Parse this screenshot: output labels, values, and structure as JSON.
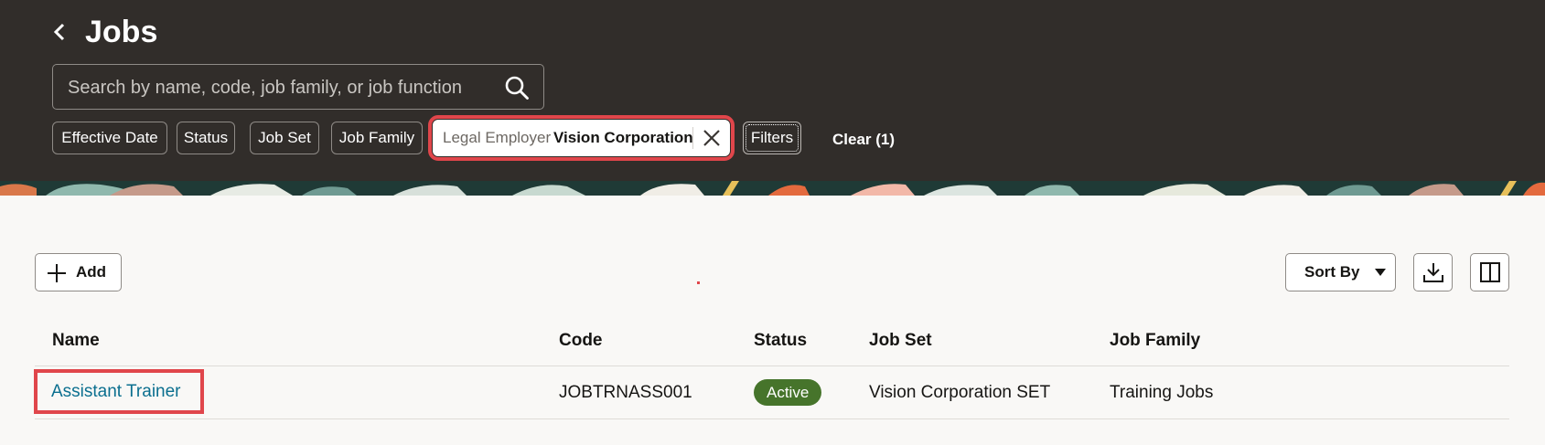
{
  "header": {
    "title": "Jobs",
    "back_icon": "chevron-left-icon"
  },
  "search": {
    "placeholder": "Search by name, code, job family, or job function",
    "value": ""
  },
  "filter_chips": [
    {
      "label": "Effective Date"
    },
    {
      "label": "Status"
    },
    {
      "label": "Job Set"
    },
    {
      "label": "Job Family"
    }
  ],
  "applied_filter": {
    "label": "Legal Employer",
    "value": "Vision Corporation"
  },
  "filters_button": "Filters",
  "clear_link": "Clear (1)",
  "toolbar": {
    "add_label": "Add",
    "sort_label": "Sort By"
  },
  "table": {
    "columns": [
      "Name",
      "Code",
      "Status",
      "Job Set",
      "Job Family"
    ],
    "rows": [
      {
        "name": "Assistant Trainer",
        "code": "JOBTRNASS001",
        "status": "Active",
        "job_set": "Vision Corporation SET",
        "job_family": "Training Jobs"
      }
    ]
  },
  "colors": {
    "header_bg": "#312d2a",
    "page_bg": "#f9f8f6",
    "highlight": "#e0464b",
    "link": "#0b6f8f",
    "status_active": "#46742b"
  }
}
